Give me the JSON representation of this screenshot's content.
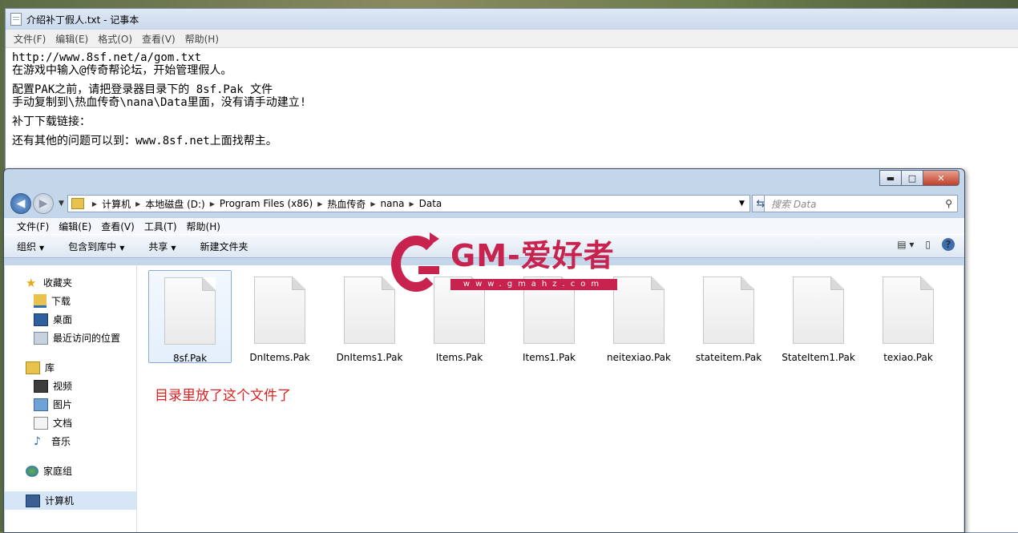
{
  "notepad": {
    "title": "介绍补丁假人.txt - 记事本",
    "menu": [
      "文件(F)",
      "编辑(E)",
      "格式(O)",
      "查看(V)",
      "帮助(H)"
    ],
    "lines": [
      "http://www.8sf.net/a/gom.txt",
      "在游戏中输入@传奇帮论坛，开始管理假人。",
      "",
      "配置PAK之前，请把登录器目录下的 8sf.Pak 文件",
      "手动复制到\\热血传奇\\nana\\Data里面，没有请手动建立!",
      "",
      "补丁下载链接：",
      "",
      "还有其他的问题可以到：www.8sf.net上面找帮主。"
    ]
  },
  "explorer": {
    "caption_buttons": {
      "minimize": "▬",
      "maximize": "□",
      "close": "✕"
    },
    "breadcrumbs": [
      "计算机",
      "本地磁盘 (D:)",
      "Program Files (x86)",
      "热血传奇",
      "nana",
      "Data"
    ],
    "search_placeholder": "搜索 Data",
    "menu": [
      "文件(F)",
      "编辑(E)",
      "查看(V)",
      "工具(T)",
      "帮助(H)"
    ],
    "toolbar": {
      "organize": "组织",
      "include_library": "包含到库中",
      "share": "共享",
      "new_folder": "新建文件夹"
    },
    "nav": {
      "favorites": "收藏夹",
      "favorites_items": [
        "下载",
        "桌面",
        "最近访问的位置"
      ],
      "libraries": "库",
      "libraries_items": [
        "视频",
        "图片",
        "文档",
        "音乐"
      ],
      "homegroup": "家庭组",
      "computer": "计算机"
    },
    "files": [
      "8sf.Pak",
      "DnItems.Pak",
      "DnItems1.Pak",
      "Items.Pak",
      "Items1.Pak",
      "neitexiao.Pak",
      "stateitem.Pak",
      "StateItem1.Pak",
      "texiao.Pak"
    ],
    "selected_file_index": 0,
    "note": "目录里放了这个文件了"
  },
  "watermark": {
    "text": "GM-爱好者",
    "url": "www.gmahz.com",
    "color": "#c8224e"
  }
}
